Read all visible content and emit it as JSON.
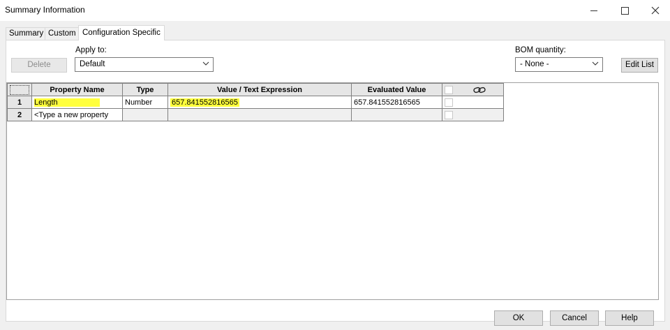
{
  "window": {
    "title": "Summary Information"
  },
  "tabs": [
    "Summary",
    "Custom",
    "Configuration Specific"
  ],
  "toolbar": {
    "delete_label": "Delete",
    "apply_to_label": "Apply to:",
    "apply_to_value": "Default",
    "bom_quantity_label": "BOM quantity:",
    "bom_quantity_value": "- None -",
    "edit_list_label": "Edit List"
  },
  "grid": {
    "columns": [
      "Property Name",
      "Type",
      "Value / Text Expression",
      "Evaluated Value"
    ],
    "link_column_icon": "link-icon",
    "rows": [
      {
        "num": "1",
        "name": "Length",
        "type": "Number",
        "value": "657.841552816565",
        "evaluated": "657.841552816565",
        "highlighted": true
      },
      {
        "num": "2",
        "name": "<Type a new property",
        "type": "",
        "value": "",
        "evaluated": "",
        "highlighted": false
      }
    ],
    "highlight_color": "#ffff3c"
  },
  "footer": {
    "ok_label": "OK",
    "cancel_label": "Cancel",
    "help_label": "Help"
  }
}
